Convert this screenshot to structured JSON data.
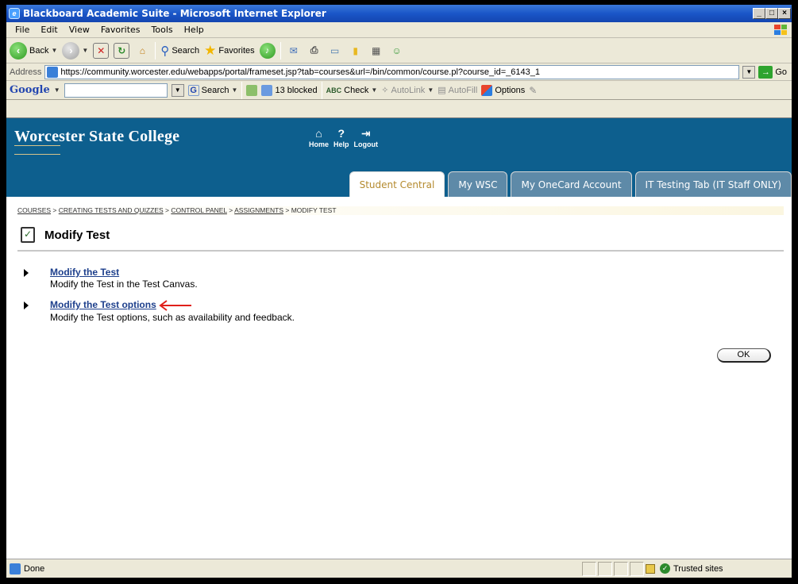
{
  "window": {
    "title": "Blackboard Academic Suite - Microsoft Internet Explorer",
    "min_glyph": "_",
    "max_glyph": "□",
    "close_glyph": "×"
  },
  "menu": [
    "File",
    "Edit",
    "View",
    "Favorites",
    "Tools",
    "Help"
  ],
  "toolbar": {
    "back_label": "Back",
    "search_label": "Search",
    "favorites_label": "Favorites"
  },
  "address": {
    "label": "Address",
    "url": "https://community.worcester.edu/webapps/portal/frameset.jsp?tab=courses&url=/bin/common/course.pl?course_id=_6143_1",
    "go_label": "Go"
  },
  "google_bar": {
    "logo": "Google",
    "search_label": "Search",
    "blocked_label": "13 blocked",
    "check_label": "Check",
    "autolink_label": "AutoLink",
    "autofill_label": "AutoFill",
    "options_label": "Options"
  },
  "site": {
    "logo_text": "Worcester State College",
    "nav": {
      "home": "Home",
      "help": "Help",
      "logout": "Logout"
    },
    "tabs": [
      {
        "label": "Student Central",
        "active": true
      },
      {
        "label": "My WSC",
        "active": false
      },
      {
        "label": "My OneCard Account",
        "active": false
      },
      {
        "label": "IT Testing Tab (IT Staff ONLY)",
        "active": false
      }
    ]
  },
  "breadcrumb": {
    "items": [
      "COURSES",
      "CREATING TESTS AND QUIZZES",
      "CONTROL PANEL",
      "ASSIGNMENTS"
    ],
    "current": "MODIFY TEST",
    "separator": " > "
  },
  "page": {
    "title": "Modify Test",
    "actions": [
      {
        "link": "Modify the Test",
        "desc": "Modify the Test in the Test Canvas."
      },
      {
        "link": "Modify the Test options",
        "desc": "Modify the Test options, such as availability and feedback."
      }
    ],
    "ok_label": "OK"
  },
  "status": {
    "text": "Done",
    "zone": "Trusted sites"
  },
  "colors": {
    "banner": "#0d5f8e",
    "link": "#1d3f8c",
    "active_tab_text": "#b48a2e",
    "annotation_arrow": "#e0201a"
  }
}
